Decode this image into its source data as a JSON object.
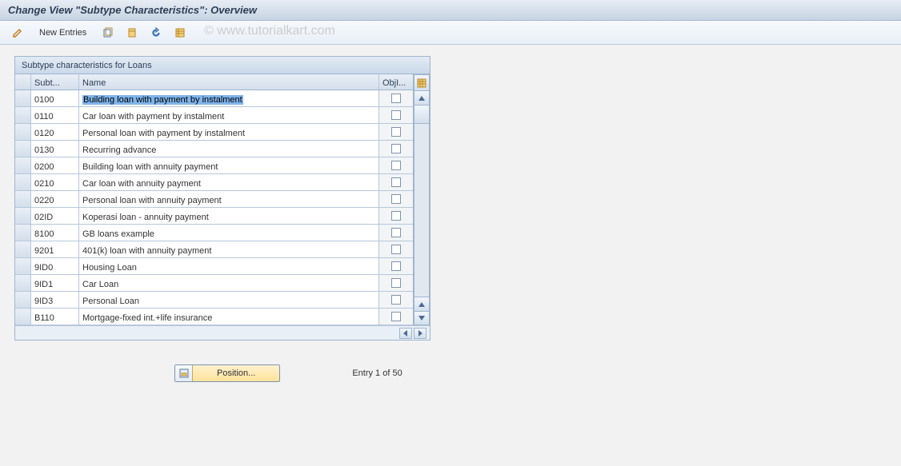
{
  "title": "Change View \"Subtype Characteristics\": Overview",
  "watermark": "© www.tutorialkart.com",
  "toolbar": {
    "new_entries_label": "New Entries"
  },
  "panel": {
    "title": "Subtype characteristics for Loans",
    "columns": {
      "selector": "",
      "code": "Subt...",
      "name": "Name",
      "obj": "ObjI..."
    }
  },
  "rows": [
    {
      "code": "0100",
      "name": "Building loan with payment by instalment",
      "obj": false
    },
    {
      "code": "0110",
      "name": "Car loan with payment by instalment",
      "obj": false
    },
    {
      "code": "0120",
      "name": "Personal loan with payment by instalment",
      "obj": false
    },
    {
      "code": "0130",
      "name": "Recurring advance",
      "obj": false
    },
    {
      "code": "0200",
      "name": "Building loan with annuity payment",
      "obj": false
    },
    {
      "code": "0210",
      "name": "Car loan with annuity payment",
      "obj": false
    },
    {
      "code": "0220",
      "name": "Personal loan with annuity payment",
      "obj": false
    },
    {
      "code": "02ID",
      "name": "Koperasi loan - annuity payment",
      "obj": false
    },
    {
      "code": "8100",
      "name": "GB loans example",
      "obj": false
    },
    {
      "code": "9201",
      "name": "401(k) loan with annuity payment",
      "obj": false
    },
    {
      "code": "9ID0",
      "name": "Housing Loan",
      "obj": false
    },
    {
      "code": "9ID1",
      "name": "Car Loan",
      "obj": false
    },
    {
      "code": "9ID3",
      "name": "Personal Loan",
      "obj": false
    },
    {
      "code": "B110",
      "name": "Mortgage-fixed int.+life insurance",
      "obj": false
    }
  ],
  "footer": {
    "position_label": "Position...",
    "entry_text": "Entry 1 of 50"
  }
}
